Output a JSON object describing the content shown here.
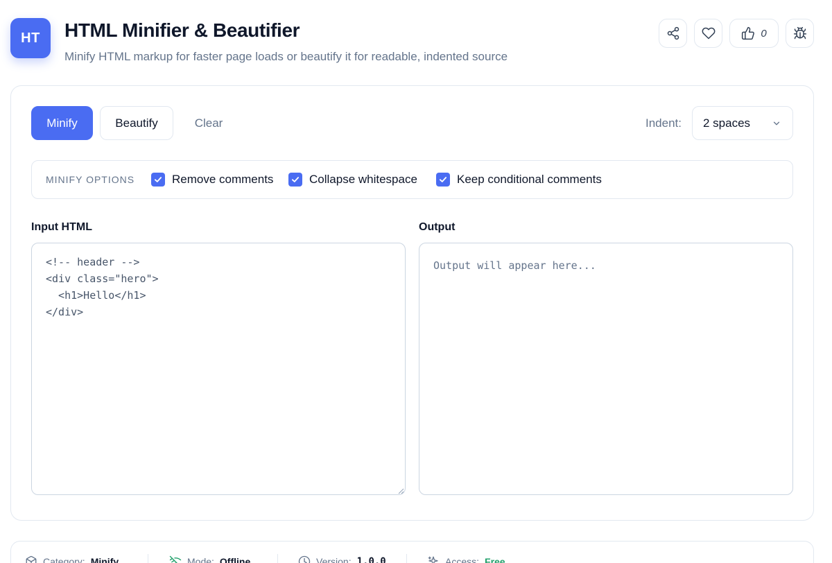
{
  "header": {
    "logo_text": "HT",
    "title": "HTML Minifier & Beautifier",
    "subtitle": "Minify HTML markup for faster page loads or beautify it for readable, indented source",
    "like_count": "0"
  },
  "toolbar": {
    "minify_label": "Minify",
    "beautify_label": "Beautify",
    "clear_label": "Clear",
    "indent_label": "Indent:",
    "indent_value": "2 spaces"
  },
  "options": {
    "title": "MINIFY OPTIONS",
    "items": [
      {
        "label": "Remove comments",
        "checked": true
      },
      {
        "label": "Collapse whitespace",
        "checked": true
      },
      {
        "label": "Keep conditional comments",
        "checked": true
      }
    ]
  },
  "input": {
    "label": "Input HTML",
    "value": "<!-- header -->\n<div class=\"hero\">\n  <h1>Hello</h1>\n</div>"
  },
  "output": {
    "label": "Output",
    "placeholder": "Output will appear here..."
  },
  "footer": {
    "category_label": "Category:",
    "category_value": "Minify",
    "mode_label": "Mode:",
    "mode_value": "Offline",
    "version_label": "Version:",
    "version_value": "1.0.0",
    "access_label": "Access:",
    "access_value": "Free"
  },
  "colors": {
    "accent": "#4a6cf2",
    "muted_text": "#64748b",
    "border": "#e2e8f0",
    "free_green": "#22a06b"
  },
  "icons": {
    "share": "share-icon",
    "favorite": "heart-icon",
    "like": "thumbs-up-icon",
    "report": "bug-icon",
    "dropdown": "chevron-down-icon",
    "category": "box-icon",
    "mode": "wifi-off-icon",
    "version": "clock-icon",
    "access": "sparkle-icon"
  }
}
